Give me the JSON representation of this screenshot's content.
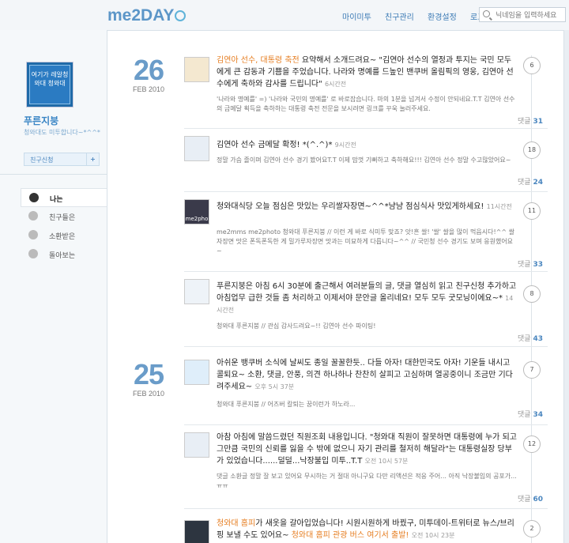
{
  "header": {
    "logo": "me2DAY",
    "nav": [
      "마이미투",
      "친구관리",
      "환경설정",
      "로그아웃"
    ],
    "search_placeholder": "닉네임을 입력하세요"
  },
  "sidebar": {
    "profile_caption": "여기가 레알청와대 청와대",
    "name": "푸른지붕",
    "desc": "청와대도 미투합니다~*^^*",
    "friend_button": "친구신청",
    "friend_plus": "+",
    "menu": [
      {
        "label": "나는",
        "active": true
      },
      {
        "label": "친구들은",
        "active": false
      },
      {
        "label": "소환받은",
        "active": false
      },
      {
        "label": "돌아보는",
        "active": false
      }
    ]
  },
  "days": [
    {
      "num": "26",
      "mon": "FEB 2010"
    },
    {
      "num": "25",
      "mon": "FEB 2010"
    }
  ],
  "posts": [
    {
      "link": "김연아 선수, 대통령 축전",
      "text": " 요약해서 소개드려요~ \"김연아 선수의 열정과 투지는 국민 모두에게 큰 감동과 기쁨을 주었습니다. 나라와 명예를 드높인 밴쿠버 올림픽의 영웅, 김연아 선수에게 축하와 감사를 드립니다\"",
      "time": "6시간전",
      "sub": "'나라와 명예를' =) '나라와 국민의 명예를' 로 바로잡습니다. 마의 1분을 넘겨서 수정이 안되네요.T.T 김연아 선수의 금메달 획득을 축하하는 대통령 축전 전문을 보시려면 링크를 꾸욱 눌러주세요.",
      "count": "6",
      "reply_label": "댓글",
      "reply_count": "31"
    },
    {
      "link": "",
      "text": "김연아 선수 금메달 확정! *(^.^)*",
      "time": "9시간전",
      "sub": "정말 가슴 졸이며 김연아 선수 경기 봤어요T.T 이제 맘껏 기뻐하고 축하해요!!! 김연아 선수 정말 수고많았어요~",
      "count": "18",
      "reply_label": "댓글",
      "reply_count": "24"
    },
    {
      "link": "",
      "text": "청와대식당 오늘 점심은 맛있는 우리쌀자장면~^^*냠냠 점심식사 맛있게하세요!",
      "time": "11시간전",
      "avatar_text": "me2pho",
      "sub": "me2mms me2photo   청와대 푸른지붕 // 이런 게 바로 식미투 맞죠? 앗!흔 쌀! '쌀' 쌀을 많이 먹읍시다!^^ 쌀자장면 맛은 폰독폰독한 게 밀가루자장면 맛과는 미묘하게 다릅니다~^^ // 국민청 선수 경기도 보며 응원했어요~",
      "count": "11",
      "reply_label": "댓글",
      "reply_count": "33"
    },
    {
      "link": "",
      "text": "푸른지붕은 아침 6시 30분에 출근해서 여러분들의 글, 댓글 열심히 읽고 친구신청 추가하고 아침업무 급한 것들 좀 처리하고 이제서야 문안글 올리네요! 모두 모두 굿모닝이에요~*",
      "time": "14시간전",
      "sub": "청와대 푸른지붕 // 관심 감사드려요~!! 김연아 선수 파이팅!",
      "count": "8",
      "reply_label": "댓글",
      "reply_count": "43"
    },
    {
      "link": "",
      "text": "아쉬운 뱅쿠버 소식에 날씨도 종일 꿀꿀한듯.. 다들 아자! 대한민국도 아자! 기운들 내시고 콜퇴요~ 소환, 댓글, 안풍, 의견 하나하나 찬찬히 살피고 고심하며 열공중이니 조금만 기다려주세요~",
      "time": "오후 5시 37분",
      "sub": "청와대 푸른지붕 // 어즈버 칼퇴는 꿈이런가 하노라...",
      "count": "7",
      "reply_label": "댓글",
      "reply_count": "34"
    },
    {
      "link": "",
      "text": "아참 아침에 말씀드렸던 직원조회 내용입니다. \"청와대 직원이 잘못하면 대통령에 누가 되고 그만큼 국민의 신뢰를 잃을 수 밖에 없으니 자기 관리를 철저히 해달라\"는 대통령실장 당부가 있었습니다......덜덜...낙장불입 미투..T.T",
      "time": "오전 10시 57분",
      "sub": "댓글 소환글 정말 잘 보고 있어요 무시하는 거 절대 아니구요 다만 리액션은 적응 주어... 아직 낙장불입의 공포가... ㅠㅠ",
      "count": "12",
      "reply_label": "댓글",
      "reply_count": "60"
    },
    {
      "link": "청와대 홈피",
      "text": "가 새옷을 갈아입었습니다! 시원시원하게 바꿨구, 미투데이-트위터로 뉴스/브리핑 보낼 수도 있어요~ ",
      "link2": "청와대 홈피 관광 버스 여기서 출발!",
      "time": "오전 10시 23분",
      "count": "2"
    }
  ]
}
